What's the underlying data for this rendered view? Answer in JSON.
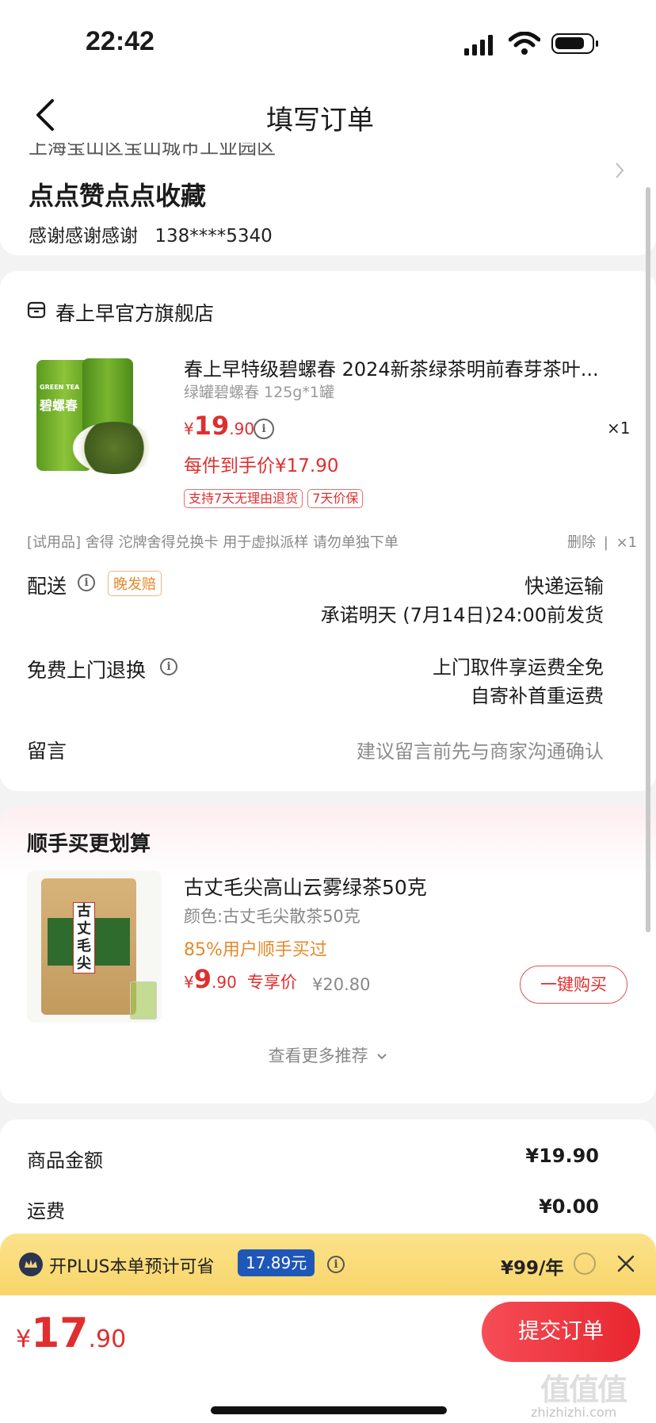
{
  "status_bar": {
    "time": "22:42"
  },
  "header": {
    "title": "填写订单"
  },
  "address": {
    "partial_line": "上海宝山区宝山城市工业园区",
    "name": "点点赞点点收藏",
    "contact_name": "感谢感谢感谢",
    "phone": "138****5340"
  },
  "store": {
    "name": "春上早官方旗舰店"
  },
  "product": {
    "title": "春上早特级碧螺春 2024新茶绿茶明前春芽茶叶...",
    "spec": "绿罐碧螺春 125g*1罐",
    "price_symbol": "¥",
    "price_int": "19",
    "price_dec": ".90",
    "quantity": "×1",
    "final_price": "每件到手价¥17.90",
    "tags": [
      "支持7天无理由退货",
      "7天价保"
    ],
    "image_label_en": "GREEN TEA",
    "image_label_cn": "碧螺春"
  },
  "trial": {
    "text": "[试用品] 舍得 沱牌舍得兑换卡 用于虚拟派样 请勿单独下单",
    "delete": "删除",
    "divider": "|",
    "qty": "×1"
  },
  "delivery": {
    "label": "配送",
    "badge": "晚发赔",
    "method": "快递运输",
    "promise": "承诺明天 (7月14日)24:00前发货"
  },
  "return": {
    "label": "免费上门退换",
    "line1": "上门取件享运费全免",
    "line2": "自寄补首重运费"
  },
  "note": {
    "label": "留言",
    "placeholder": "建议留言前先与商家沟通确认"
  },
  "recommend": {
    "title": "顺手买更划算",
    "item_title": "古丈毛尖高山云雾绿茶50克",
    "item_color": "颜色:古丈毛尖散茶50克",
    "item_users": "85%用户顺手买过",
    "price_symbol": "¥",
    "price_int": "9",
    "price_dec": ".90",
    "exclusive": "专享价",
    "original_price": "¥20.80",
    "buy_button": "一键购买",
    "image_label": "古丈毛尖",
    "more": "查看更多推荐"
  },
  "summary": {
    "goods_label": "商品金额",
    "goods_value": "¥19.90",
    "shipping_label": "运费",
    "shipping_value": "¥0.00"
  },
  "plus_bar": {
    "text": "开PLUS本单预计可省",
    "amount": "17.89元",
    "price": "¥99/年"
  },
  "footer": {
    "total_symbol": "¥",
    "total_int": "17",
    "total_dec": ".90",
    "submit": "提交订单"
  },
  "watermark": {
    "cn": "值值值",
    "url": "zhizhizhi.com"
  }
}
